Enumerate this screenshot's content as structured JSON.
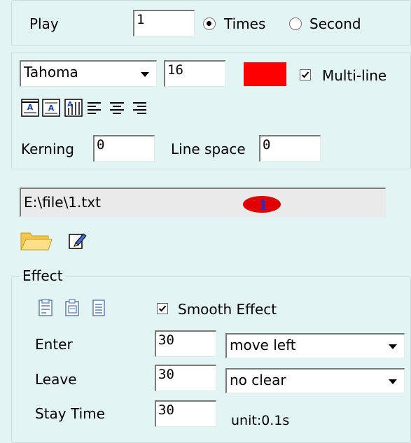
{
  "play": {
    "label": "Play",
    "value": "1",
    "mode_options": [
      "Times",
      "Second"
    ],
    "selected_mode": "Times"
  },
  "font": {
    "family": "Tahoma",
    "size": "16",
    "color": "#ff0000",
    "multiline_label": "Multi-line",
    "multiline_checked": true,
    "kerning_label": "Kerning",
    "kerning_value": "0",
    "line_space_label": "Line space",
    "line_space_value": "0"
  },
  "file": {
    "path": "E:\\file\\1.txt",
    "badge": "1",
    "badge_color": "#e00000"
  },
  "effect": {
    "title": "Effect",
    "smooth_label": "Smooth Effect",
    "smooth_checked": true,
    "enter_label": "Enter",
    "enter_value": "30",
    "enter_effect": "move left",
    "leave_label": "Leave",
    "leave_value": "30",
    "leave_effect": "no clear",
    "stay_label": "Stay Time",
    "stay_value": "30",
    "unit_text": "unit:0.1s"
  }
}
